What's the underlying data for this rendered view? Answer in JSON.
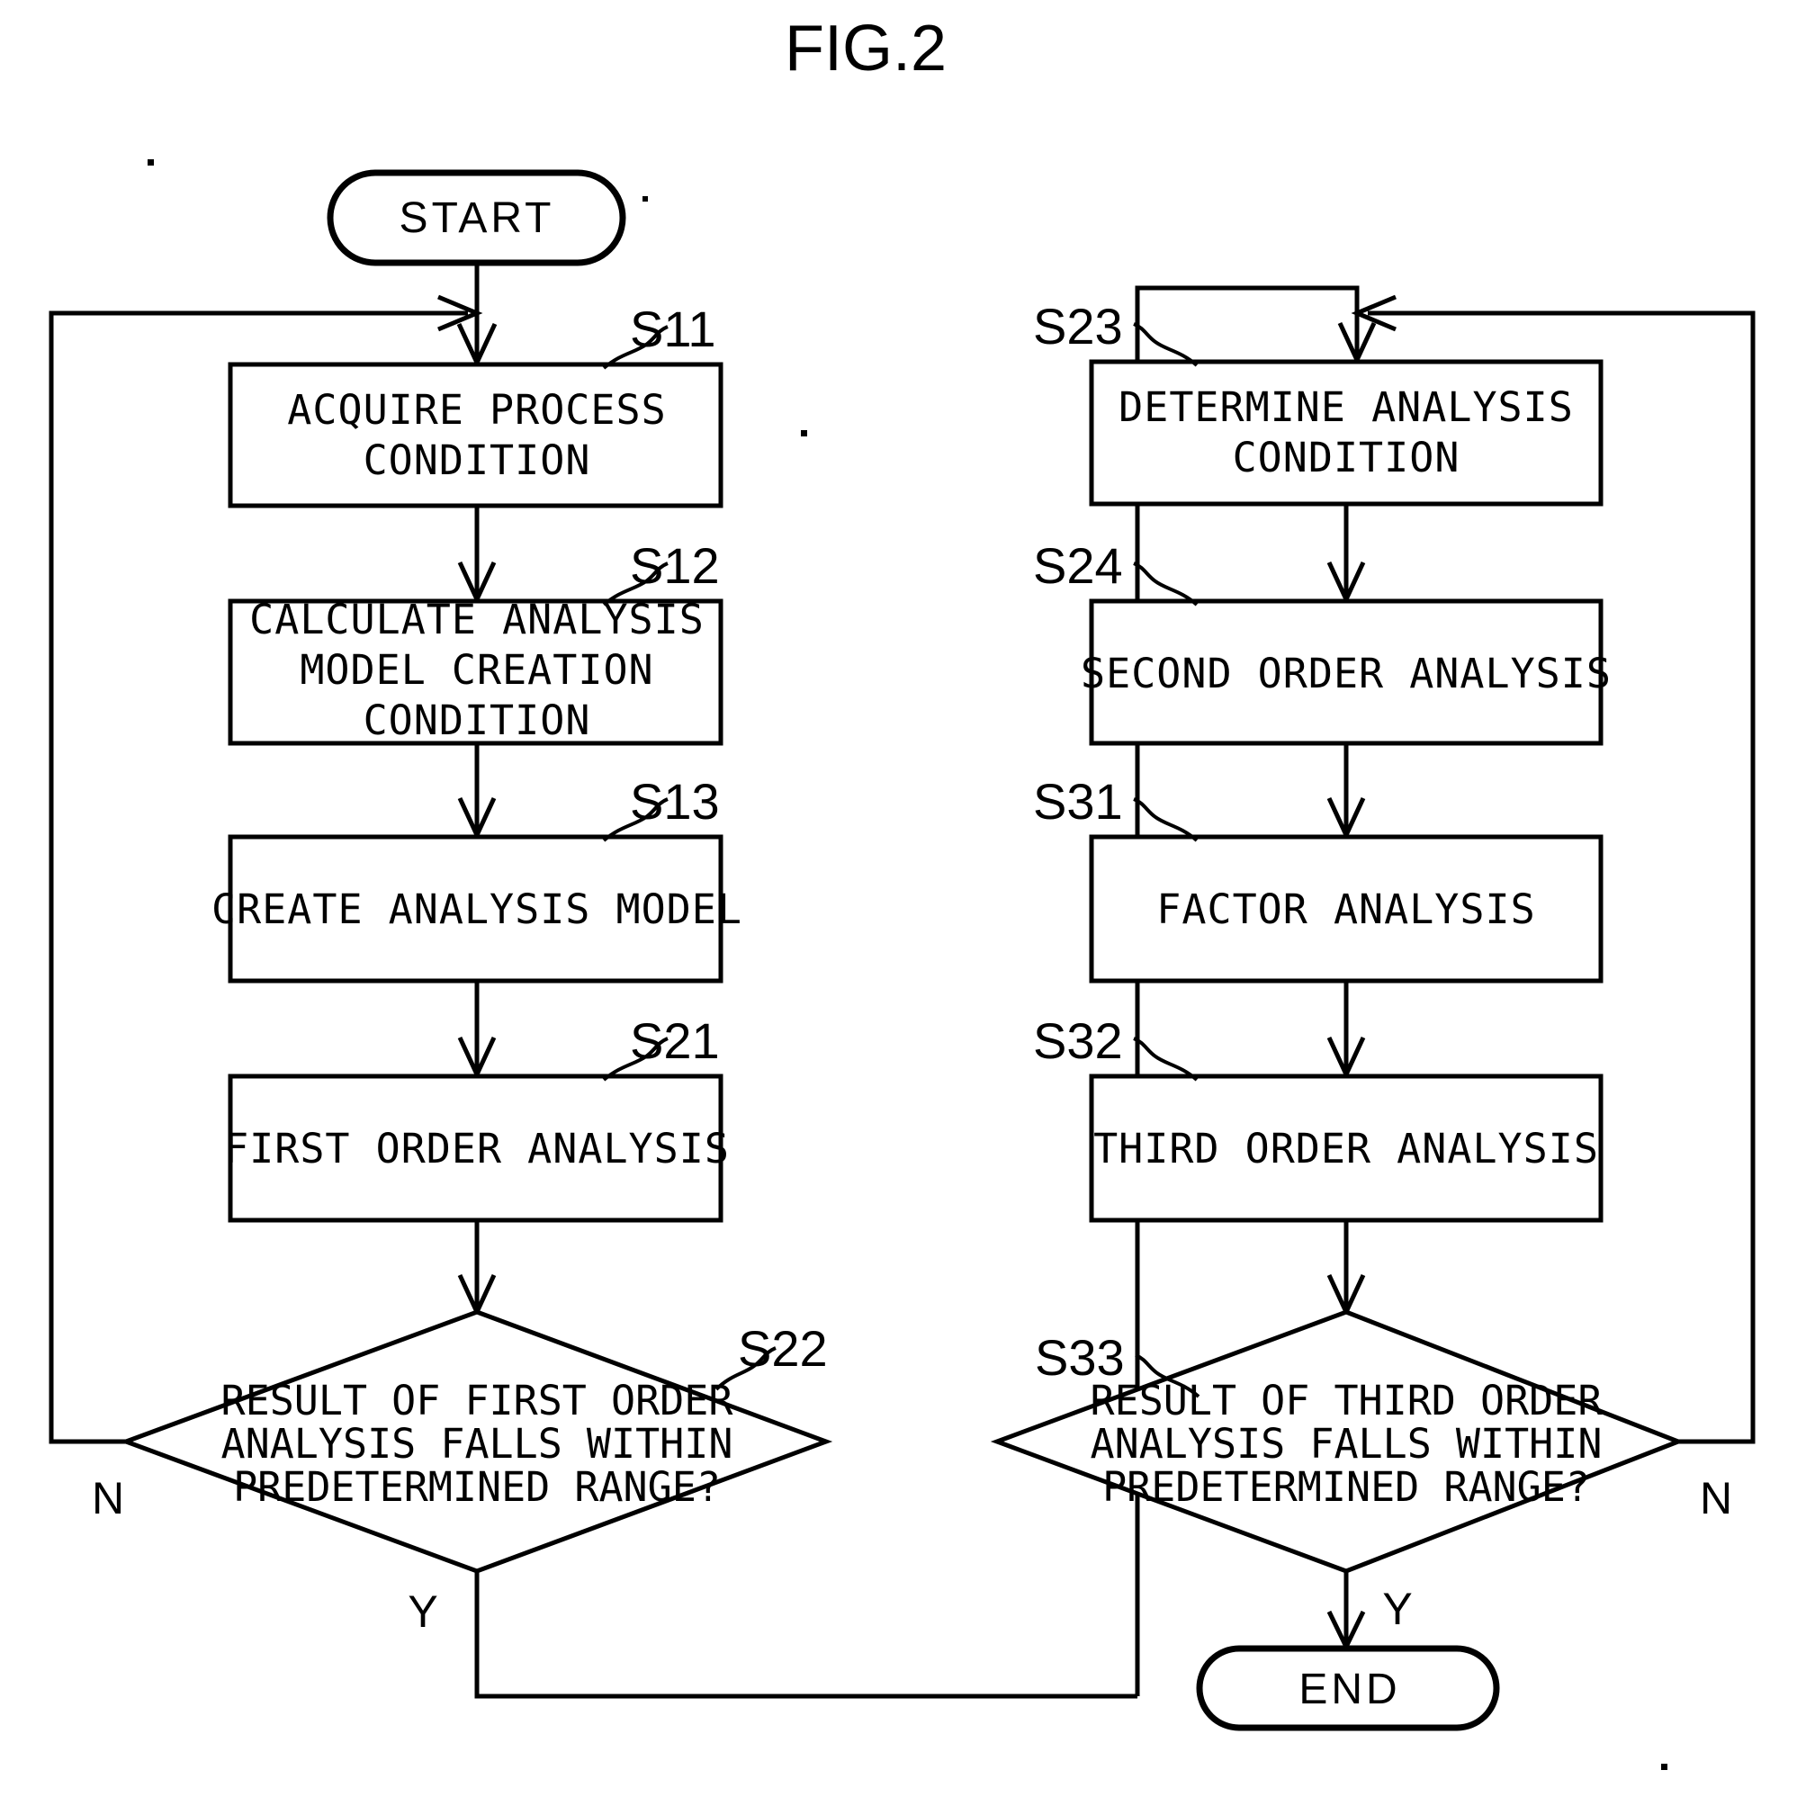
{
  "figure": {
    "title": "FIG.2",
    "type": "flowchart"
  },
  "terminals": {
    "start": "START",
    "end": "END"
  },
  "branch_labels": {
    "no_left": "N",
    "yes_left": "Y",
    "no_right": "N",
    "yes_right": "Y"
  },
  "step_refs": {
    "s11": "S11",
    "s12": "S12",
    "s13": "S13",
    "s21": "S21",
    "s22": "S22",
    "s23": "S23",
    "s24": "S24",
    "s31": "S31",
    "s32": "S32",
    "s33": "S33"
  },
  "nodes": {
    "s11": {
      "ref": "S11",
      "line1": "ACQUIRE PROCESS",
      "line2": "CONDITION"
    },
    "s12": {
      "ref": "S12",
      "line1": "CALCULATE ANALYSIS",
      "line2": "MODEL CREATION",
      "line3": "CONDITION"
    },
    "s13": {
      "ref": "S13",
      "line1": "CREATE ANALYSIS MODEL"
    },
    "s21": {
      "ref": "S21",
      "line1": "FIRST ORDER ANALYSIS"
    },
    "s22": {
      "ref": "S22",
      "line1": "RESULT OF FIRST ORDER",
      "line2": "ANALYSIS FALLS WITHIN",
      "line3": "PREDETERMINED RANGE?"
    },
    "s23": {
      "ref": "S23",
      "line1": "DETERMINE ANALYSIS",
      "line2": "CONDITION"
    },
    "s24": {
      "ref": "S24",
      "line1": "SECOND ORDER ANALYSIS"
    },
    "s31": {
      "ref": "S31",
      "line1": "FACTOR ANALYSIS"
    },
    "s32": {
      "ref": "S32",
      "line1": "THIRD ORDER ANALYSIS"
    },
    "s33": {
      "ref": "S33",
      "line1": "RESULT OF THIRD ORDER",
      "line2": "ANALYSIS FALLS WITHIN",
      "line3": "PREDETERMINED RANGE?"
    }
  },
  "colors": {
    "ink": "#000000",
    "paper": "#ffffff"
  }
}
